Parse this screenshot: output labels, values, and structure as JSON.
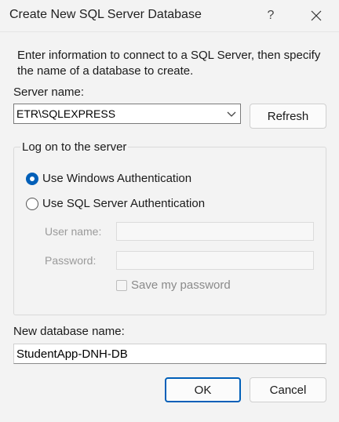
{
  "window": {
    "title": "Create New SQL Server Database",
    "help_glyph": "?"
  },
  "intro": "Enter information to connect to a SQL Server, then specify the name of a database to create.",
  "server": {
    "label": "Server name:",
    "value": "ETR\\SQLEXPRESS",
    "refresh_label": "Refresh"
  },
  "logon": {
    "legend": "Log on to the server",
    "windows_auth_label": "Use Windows Authentication",
    "windows_auth_selected": true,
    "sql_auth_label": "Use SQL Server Authentication",
    "sql_auth_selected": false,
    "username_label": "User name:",
    "username_value": "",
    "password_label": "Password:",
    "password_value": "",
    "save_password_label": "Save my password",
    "save_password_checked": false
  },
  "database": {
    "label": "New database name:",
    "value": "StudentApp-DNH-DB"
  },
  "buttons": {
    "ok_label": "OK",
    "cancel_label": "Cancel"
  },
  "colors": {
    "accent": "#005fb8"
  }
}
